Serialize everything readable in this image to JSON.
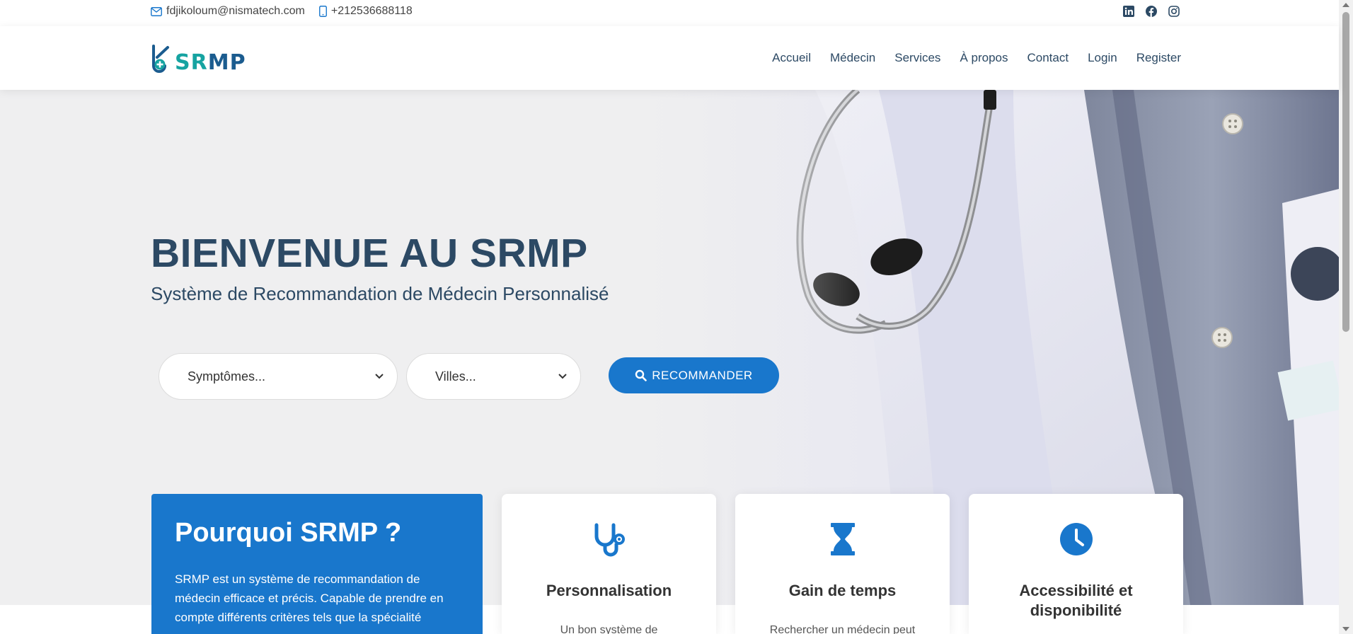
{
  "topbar": {
    "email": "fdjikoloum@nismatech.com",
    "phone": "+212536688118",
    "social": [
      "linkedin-icon",
      "facebook-icon",
      "instagram-icon"
    ]
  },
  "header": {
    "logo": {
      "s": "S",
      "r": "R",
      "mp": "MP"
    },
    "nav": [
      "Accueil",
      "Médecin",
      "Services",
      "À propos",
      "Contact",
      "Login",
      "Register"
    ]
  },
  "hero": {
    "title": "BIENVENUE AU SRMP",
    "subtitle": "Système de Recommandation de Médecin Personnalisé",
    "symptoms_select": "Symptômes...",
    "cities_select": "Villes...",
    "recommend_button": "RECOMMANDER"
  },
  "why": {
    "title": "Pourquoi SRMP ?",
    "text": "SRMP est un système de recommandation de médecin efficace et précis. Capable de prendre en compte différents critères tels que la spécialité"
  },
  "cards": [
    {
      "title": "Personnalisation",
      "text": "Un bon système de",
      "icon": "stethoscope-icon"
    },
    {
      "title": "Gain de temps",
      "text": "Rechercher un médecin peut",
      "icon": "hourglass-icon"
    },
    {
      "title": "Accessibilité et disponibilité",
      "text": "",
      "icon": "clock-icon"
    }
  ],
  "colors": {
    "primary": "#1977cc",
    "heading": "#2c4964",
    "logo_teal": "#16a3a1",
    "logo_blue": "#1b5c8f",
    "hero_bg": "#efeff0"
  }
}
